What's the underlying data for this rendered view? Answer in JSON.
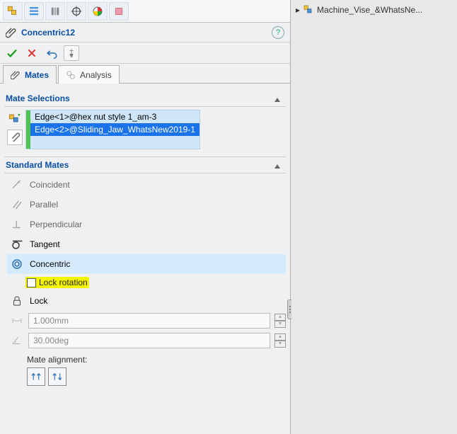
{
  "right_tree": {
    "label": "Machine_Vise_&WhatsNe..."
  },
  "title": "Concentric12",
  "tabs": {
    "mates": "Mates",
    "analysis": "Analysis"
  },
  "mate_selections_hdr": "Mate Selections",
  "selections": [
    "Edge<1>@hex nut style 1_am-3",
    "Edge<2>@Sliding_Jaw_WhatsNew2019-1"
  ],
  "standard_mates_hdr": "Standard Mates",
  "mates": {
    "coincident": "Coincident",
    "parallel": "Parallel",
    "perpendicular": "Perpendicular",
    "tangent": "Tangent",
    "concentric": "Concentric",
    "lock": "Lock"
  },
  "lock_rotation_label": "Lock rotation",
  "distance_value": "1.000mm",
  "angle_value": "30.00deg",
  "align_label": "Mate alignment:"
}
